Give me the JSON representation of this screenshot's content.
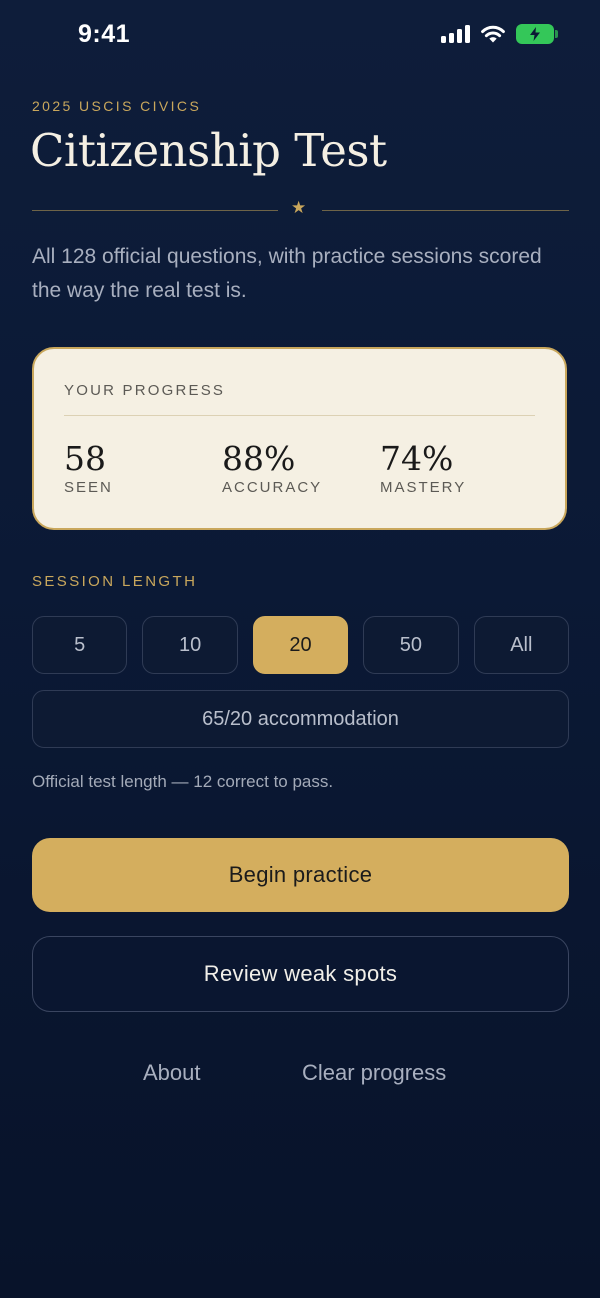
{
  "status_bar": {
    "time": "9:41"
  },
  "header": {
    "eyebrow": "2025 USCIS CIVICS",
    "title": "Citizenship Test",
    "ornament": "★",
    "intro": "All 128 official questions, with practice sessions scored the way the real test is."
  },
  "progress": {
    "label": "YOUR PROGRESS",
    "stats": [
      {
        "value": "58",
        "caption": "SEEN"
      },
      {
        "value": "88%",
        "caption": "ACCURACY"
      },
      {
        "value": "74%",
        "caption": "MASTERY"
      }
    ]
  },
  "session": {
    "label": "SESSION LENGTH",
    "options": [
      "5",
      "10",
      "20",
      "50",
      "All"
    ],
    "selected": "20",
    "accommodation": "65/20 accommodation",
    "hint": "Official test length — 12 correct to pass."
  },
  "actions": {
    "primary": "Begin practice",
    "secondary": "Review weak spots"
  },
  "footer": {
    "about": "About",
    "clear": "Clear progress"
  },
  "colors": {
    "background": "#0b1935",
    "accent_gold": "#d4ae5e",
    "card_cream": "#f5f0e3",
    "battery_green": "#34c759"
  },
  "icons": [
    "signal-icon",
    "wifi-icon",
    "battery-charging-icon",
    "star-icon"
  ]
}
